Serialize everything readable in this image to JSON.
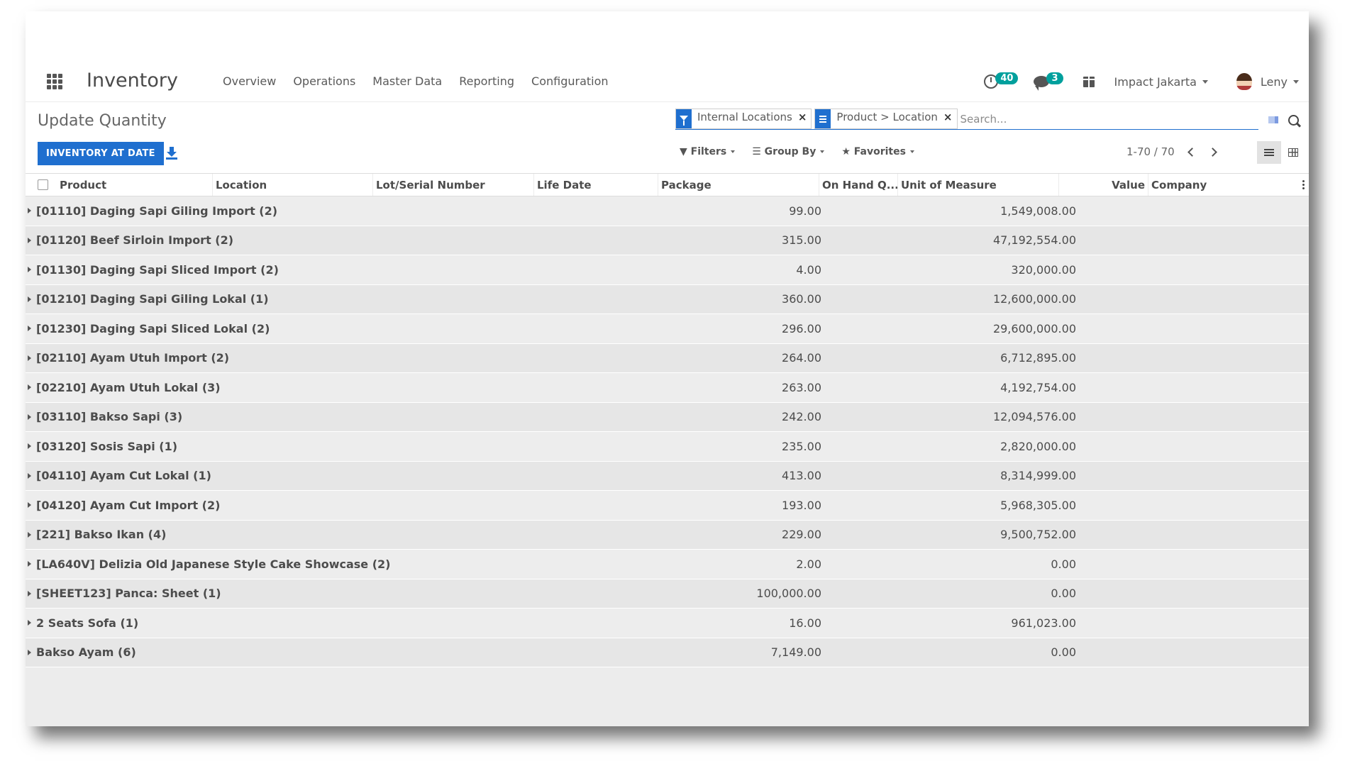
{
  "navbar": {
    "app_title": "Inventory",
    "menu": [
      "Overview",
      "Operations",
      "Master Data",
      "Reporting",
      "Configuration"
    ],
    "activity_count": "40",
    "message_count": "3",
    "company": "Impact Jakarta",
    "user": "Leny"
  },
  "control": {
    "breadcrumb": "Update Quantity",
    "primary_button": "INVENTORY AT DATE",
    "facets": [
      {
        "label": "Internal Locations",
        "icon": "filter-icon"
      },
      {
        "label": "Product > Location",
        "icon": "group-by-icon"
      }
    ],
    "search_placeholder": "Search...",
    "filters_label": "Filters",
    "groupby_label": "Group By",
    "favorites_label": "Favorites",
    "pager": "1-70 / 70"
  },
  "table": {
    "columns": [
      "Product",
      "Location",
      "Lot/Serial Number",
      "Life Date",
      "Package",
      "On Hand Q...",
      "Unit of Measure",
      "Value",
      "Company"
    ],
    "rows": [
      {
        "name": "[01110] Daging Sapi Giling Import (2)",
        "qty": "99.00",
        "value": "1,549,008.00"
      },
      {
        "name": "[01120] Beef Sirloin Import (2)",
        "qty": "315.00",
        "value": "47,192,554.00"
      },
      {
        "name": "[01130] Daging Sapi Sliced Import (2)",
        "qty": "4.00",
        "value": "320,000.00"
      },
      {
        "name": "[01210] Daging Sapi Giling Lokal (1)",
        "qty": "360.00",
        "value": "12,600,000.00"
      },
      {
        "name": "[01230] Daging Sapi Sliced Lokal (2)",
        "qty": "296.00",
        "value": "29,600,000.00"
      },
      {
        "name": "[02110] Ayam Utuh Import (2)",
        "qty": "264.00",
        "value": "6,712,895.00"
      },
      {
        "name": "[02210] Ayam Utuh Lokal (3)",
        "qty": "263.00",
        "value": "4,192,754.00"
      },
      {
        "name": "[03110] Bakso Sapi (3)",
        "qty": "242.00",
        "value": "12,094,576.00"
      },
      {
        "name": "[03120] Sosis Sapi (1)",
        "qty": "235.00",
        "value": "2,820,000.00"
      },
      {
        "name": "[04110] Ayam Cut Lokal (1)",
        "qty": "413.00",
        "value": "8,314,999.00"
      },
      {
        "name": "[04120] Ayam Cut Import (2)",
        "qty": "193.00",
        "value": "5,968,305.00"
      },
      {
        "name": "[221] Bakso Ikan (4)",
        "qty": "229.00",
        "value": "9,500,752.00"
      },
      {
        "name": "[LA640V] Delizia Old Japanese Style Cake Showcase (2)",
        "qty": "2.00",
        "value": "0.00"
      },
      {
        "name": "[SHEET123] Panca: Sheet (1)",
        "qty": "100,000.00",
        "value": "0.00"
      },
      {
        "name": "2 Seats Sofa (1)",
        "qty": "16.00",
        "value": "961,023.00"
      },
      {
        "name": "Bakso Ayam (6)",
        "qty": "7,149.00",
        "value": "0.00"
      }
    ]
  },
  "colors": {
    "primary": "#1f6fcf",
    "badge": "#00a09d"
  }
}
